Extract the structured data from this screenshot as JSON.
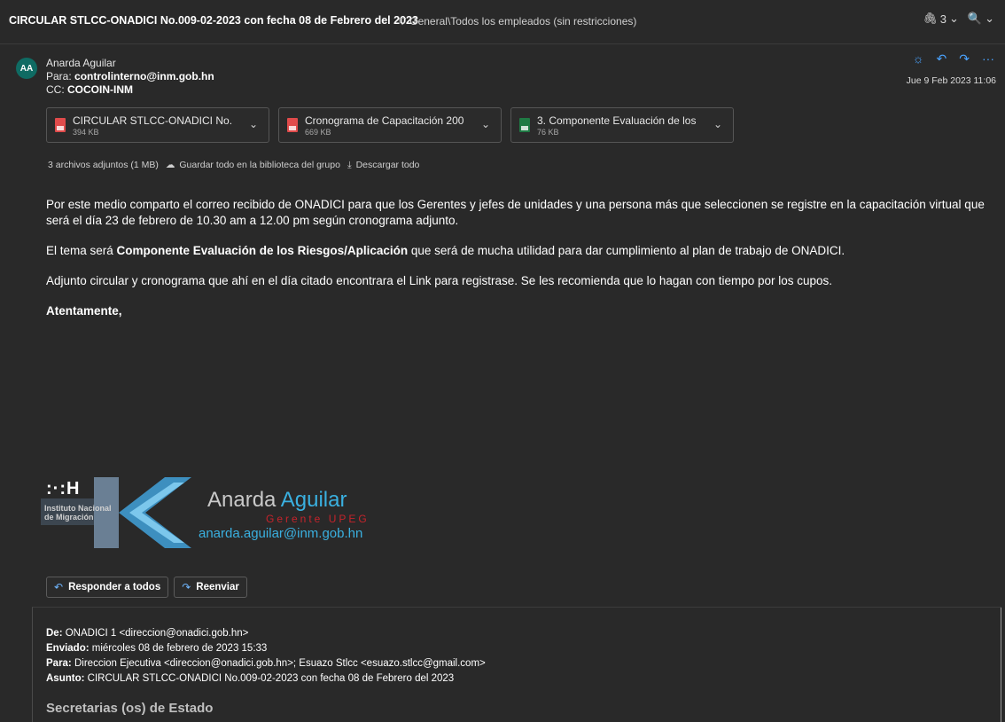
{
  "window": {
    "subject": "CIRCULAR STLCC-ONADICI No.009-02-2023 con fecha 08 de Febrero del 2023",
    "label": "General\\Todos los empleados (sin restricciones)",
    "attachment_count": "3",
    "icons": {
      "tag": "tag-icon",
      "attach": "paperclip-icon",
      "zoom": "zoom-icon"
    }
  },
  "message": {
    "avatar_initials": "AA",
    "sender_name": "Anarda Aguilar",
    "to_label": "Para:",
    "to_value": "controlinterno@inm.gob.hn",
    "cc_label": "CC:",
    "cc_value": "COCOIN-INM",
    "date": "Jue 9 Feb 2023 11:06",
    "icons": [
      "sun-icon",
      "reply-icon",
      "forward-icon",
      "more-icon"
    ]
  },
  "attachments": [
    {
      "name": "CIRCULAR STLCC-ONADICI No.00...",
      "size": "394 KB",
      "type": "pdf"
    },
    {
      "name": "Cronograma de Capacitación 200-...",
      "size": "669 KB",
      "type": "pdf"
    },
    {
      "name": "3. Componente Evaluación de los ...",
      "size": "76 KB",
      "type": "xls"
    }
  ],
  "attachments_summary": {
    "count_text": "3 archivos adjuntos (1 MB)",
    "save_all": "Guardar todo en la biblioteca del grupo",
    "download_all": "Descargar todo"
  },
  "body": {
    "p1": "Por este medio comparto el correo recibido de ONADICI para que los Gerentes y jefes de unidades y una persona más que seleccionen se registre en la capacitación virtual que será el día 23 de febrero de 10.30 am a 12.00 pm según cronograma adjunto.",
    "p2_pre": "El tema será ",
    "p2_bold": "Componente Evaluación de los Riesgos/Aplicación",
    "p2_post": " que será de mucha utilidad para dar cumplimiento al plan de trabajo de ONADICI.",
    "p3": "Adjunto circular y cronograma que ahí en el día citado encontrara el Link para registrase. Se les recomienda que lo hagan con tiempo por los cupos.",
    "closing": "Atentamente,"
  },
  "signature": {
    "logo_mark": ":·:H",
    "logo_name_1": "Instituto Nacional",
    "logo_name_2": "de Migración",
    "first_name": "Anarda",
    "last_name": "Aguilar",
    "role": "Gerente UPEG",
    "email": "anarda.aguilar@inm.gob.hn",
    "colors": {
      "accent": "#3ab0e0",
      "role": "#c5232b"
    }
  },
  "actions": {
    "reply_all": "Responder a todos",
    "forward": "Reenviar"
  },
  "quoted": {
    "from_label": "De:",
    "from_value": "ONADICI 1 <direccion@onadici.gob.hn>",
    "sent_label": "Enviado:",
    "sent_value": "miércoles 08 de febrero de 2023 15:33",
    "to_label": "Para:",
    "to_value": "Direccion Ejecutiva <direccion@onadici.gob.hn>; Esuazo Stlcc <esuazo.stlcc@gmail.com>",
    "subject_label": "Asunto:",
    "subject_value": "CIRCULAR STLCC-ONADICI No.009-02-2023 con fecha 08 de Febrero del 2023",
    "heading": "Secretarias (os) de Estado"
  }
}
